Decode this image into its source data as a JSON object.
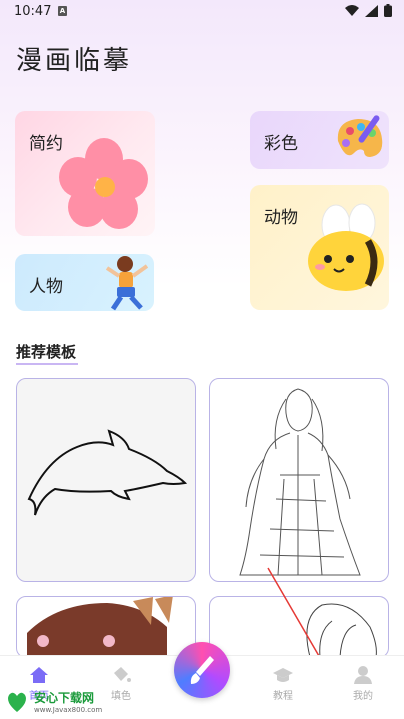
{
  "status_bar": {
    "time": "10:47",
    "sim_label": "A"
  },
  "page": {
    "title": "漫画临摹"
  },
  "categories": [
    {
      "label": "简约"
    },
    {
      "label": "彩色"
    },
    {
      "label": "动物"
    },
    {
      "label": "人物"
    }
  ],
  "section": {
    "title": "推荐模板"
  },
  "templates": [
    {
      "name": "dolphin"
    },
    {
      "name": "lady-in-robe"
    },
    {
      "name": "hat-girl"
    },
    {
      "name": "girl-sketch"
    }
  ],
  "tabbar": {
    "items": [
      {
        "label": "首页",
        "icon": "home-icon"
      },
      {
        "label": "填色",
        "icon": "paint-bucket-icon"
      },
      {
        "label": "教程",
        "icon": "graduation-cap-icon"
      },
      {
        "label": "我的",
        "icon": "user-icon"
      }
    ],
    "active_color": "#7b6cf6"
  },
  "watermark": {
    "name": "安心下载网",
    "url": "www.Javax800.com"
  }
}
